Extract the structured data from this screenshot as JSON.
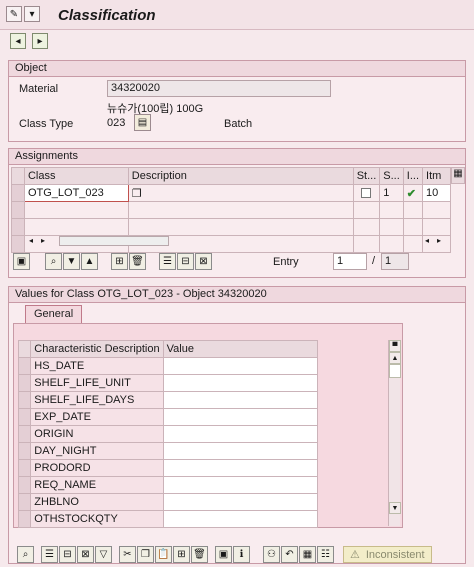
{
  "window": {
    "title": "Classification"
  },
  "object": {
    "header": "Object",
    "material_label": "Material",
    "material_value": "34320020",
    "material_desc": "뉴슈가(100립) 100G",
    "class_type_label": "Class Type",
    "class_type_value": "023",
    "class_type_desc": "Batch"
  },
  "assignments": {
    "header": "Assignments",
    "columns": [
      "Class",
      "Description",
      "St...",
      "S...",
      "I...",
      "Itm"
    ],
    "rows": [
      {
        "class": "OTG_LOT_023",
        "description": "",
        "s": "1",
        "itm": "10"
      }
    ],
    "entry_label": "Entry",
    "entry_current": "1",
    "entry_separator": "/",
    "entry_total": "1"
  },
  "values": {
    "header": "Values for Class OTG_LOT_023 - Object 34320020",
    "tab_label": "General",
    "columns": [
      "Characteristic Description",
      "Value"
    ],
    "characteristics": [
      "HS_DATE",
      "SHELF_LIFE_UNIT",
      "SHELF_LIFE_DAYS",
      "EXP_DATE",
      "ORIGIN",
      "DAY_NIGHT",
      "PRODORD",
      "REQ_NAME",
      "ZHBLNO",
      "OTHSTOCKQTY"
    ],
    "inconsistent_label": "Inconsistent"
  }
}
